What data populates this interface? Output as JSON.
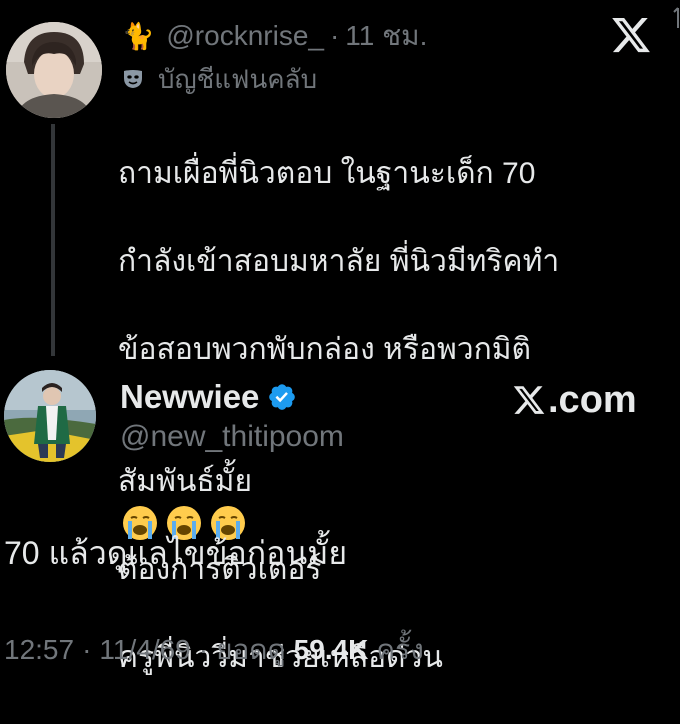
{
  "quoted": {
    "emoji": "🐈",
    "handle": "@rocknrise_",
    "separator": "·",
    "time": "11 ชม.",
    "fan_label": "บัญชีแฟนคลับ",
    "text_line1": "ถามเผื่อพี่นิวตอบ ในฐานะเด็ก 70",
    "text_line2": "กำลังเข้าสอบมหาลัย พี่นิวมีทริคทำ",
    "text_line3": "ข้อสอบพวกพับกล่อง หรือพวกมิติ",
    "text_line4_pre": "สัมพันธ์มั้ย",
    "text_line4_post": "ต้องการติวเตอร์",
    "text_line5": "ครูพี่นิววี่มาช่วยเหลือด่วน",
    "cry_emoji": "😭"
  },
  "author": {
    "name": "Newwiee",
    "handle": "@new_thitipoom",
    "watermark": "X.com"
  },
  "reply": {
    "text": "70 แล้วดูแลไขข้อก่อนมั้ย"
  },
  "footer": {
    "time": "12:57",
    "date": "11/4/69",
    "separator": "·",
    "views_label": "ยอดดู",
    "views": "59.4K",
    "views_suffix": "ครั้ง"
  },
  "colors": {
    "background": "#000000",
    "text_primary": "#e7e9ea",
    "text_secondary": "#71767b",
    "verified": "#1d9bf0"
  }
}
